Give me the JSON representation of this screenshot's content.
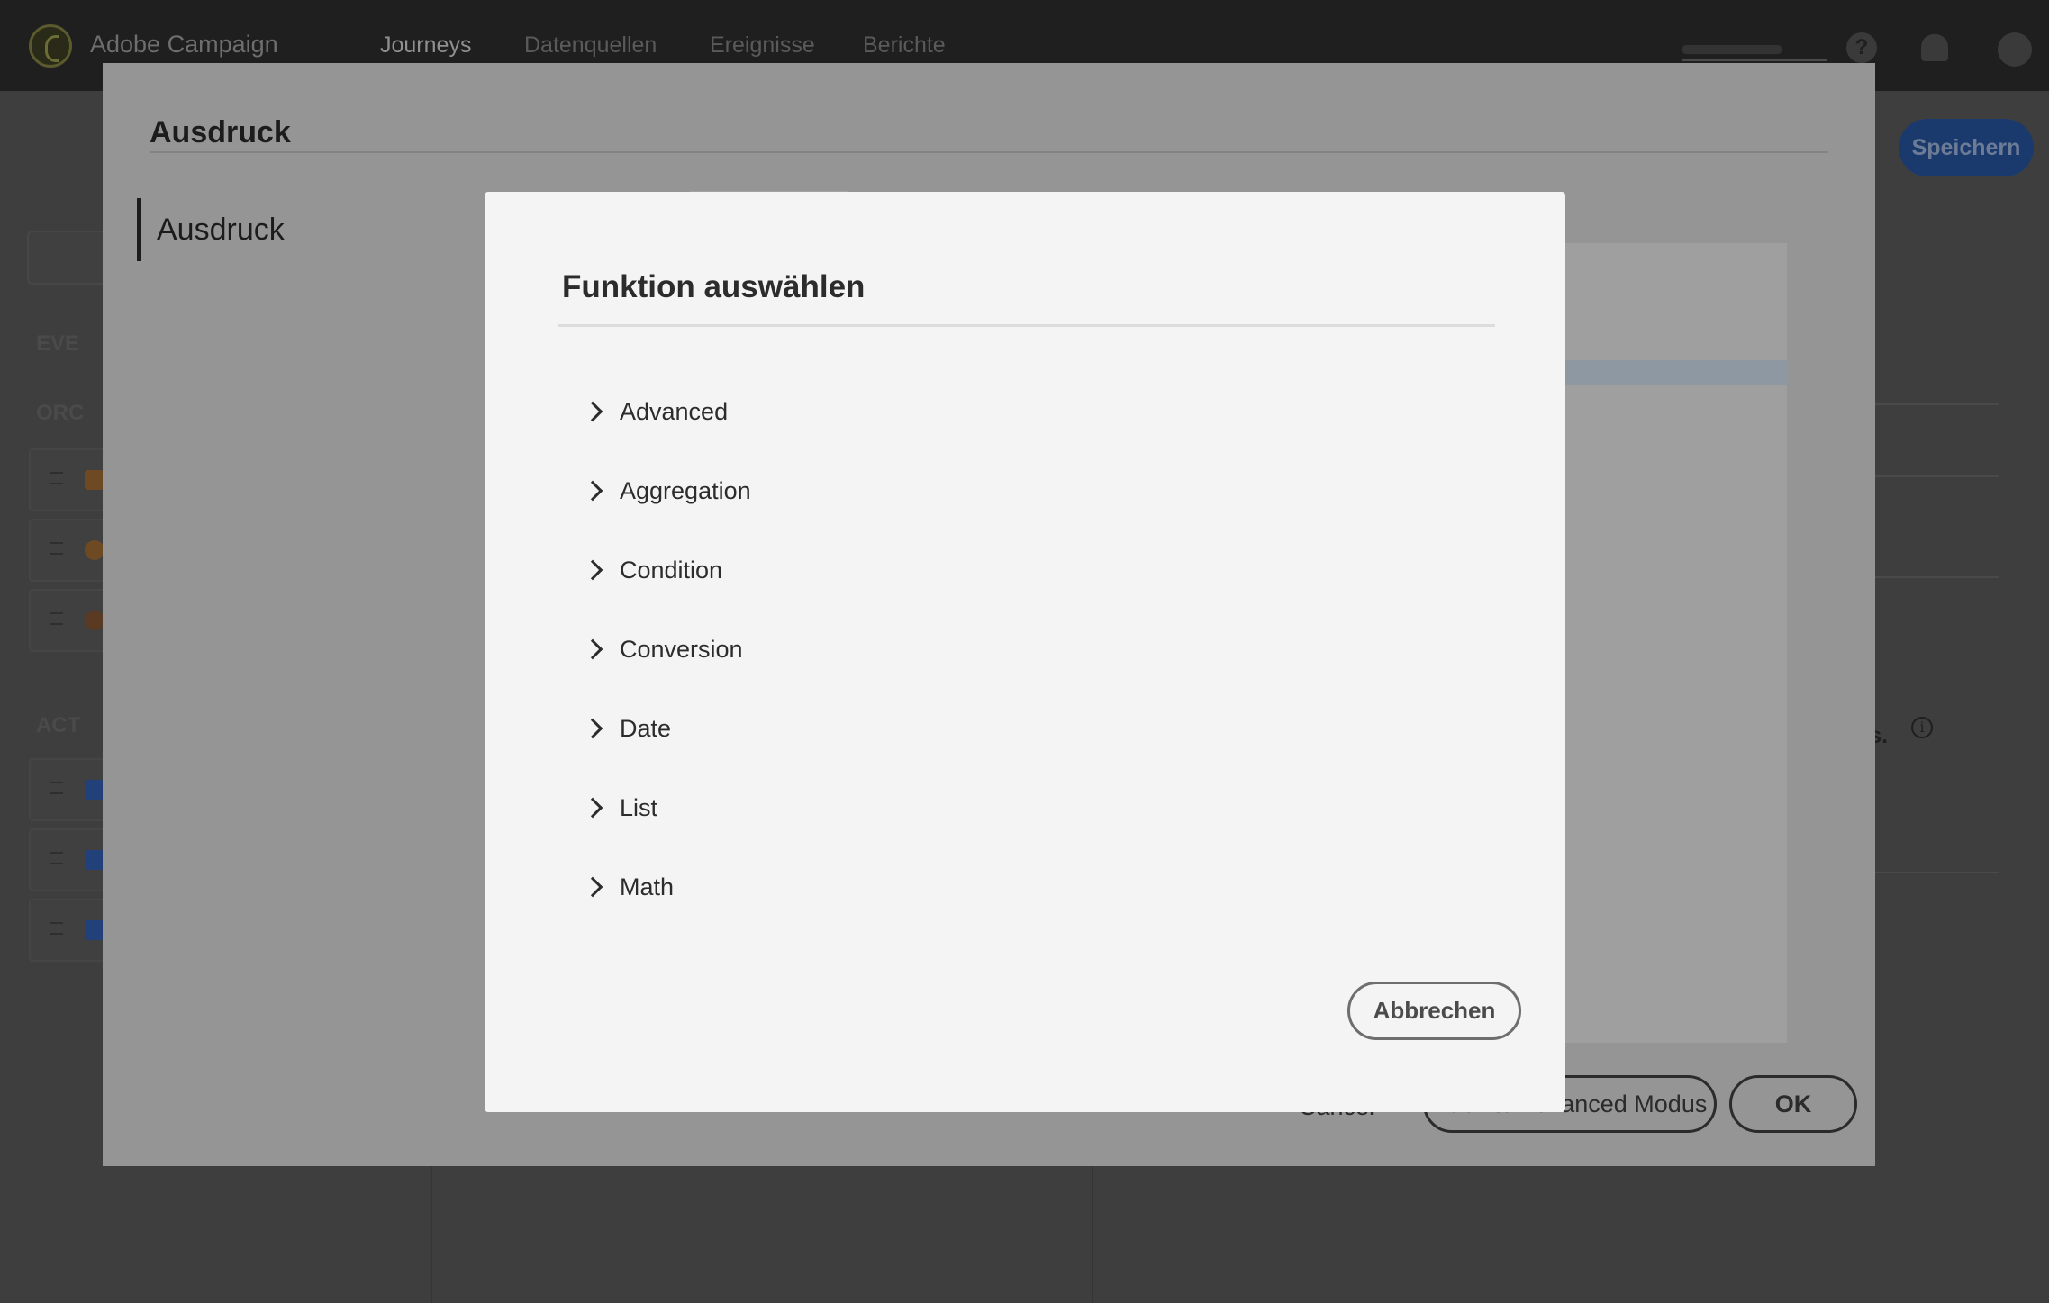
{
  "app": {
    "brand": "Adobe Campaign",
    "nav": [
      "Journeys",
      "Datenquellen",
      "Ereignisse",
      "Berichte"
    ],
    "save_label": "Speichern",
    "help_glyph": "?",
    "info_glyph": "i",
    "right_fragment": "ns."
  },
  "left_panel": {
    "sections": [
      "EVE",
      "ORC",
      "ACT"
    ],
    "row_icon_colors": [
      "#a0632a",
      "#a0632a",
      "#7a4a2a",
      "#2b4f9c",
      "#2b4f9c",
      "#2b4f9c"
    ]
  },
  "outer_modal": {
    "title": "Ausdruck",
    "side_nav_item": "Ausdruck",
    "footer": {
      "cancel_label": "Cancel",
      "back_label": "Back to Advanced Modus",
      "ok_label": "OK"
    }
  },
  "dialog": {
    "title": "Funktion auswählen",
    "categories": [
      "Advanced",
      "Aggregation",
      "Condition",
      "Conversion",
      "Date",
      "List",
      "Math"
    ],
    "cancel_label": "Abbrechen"
  }
}
